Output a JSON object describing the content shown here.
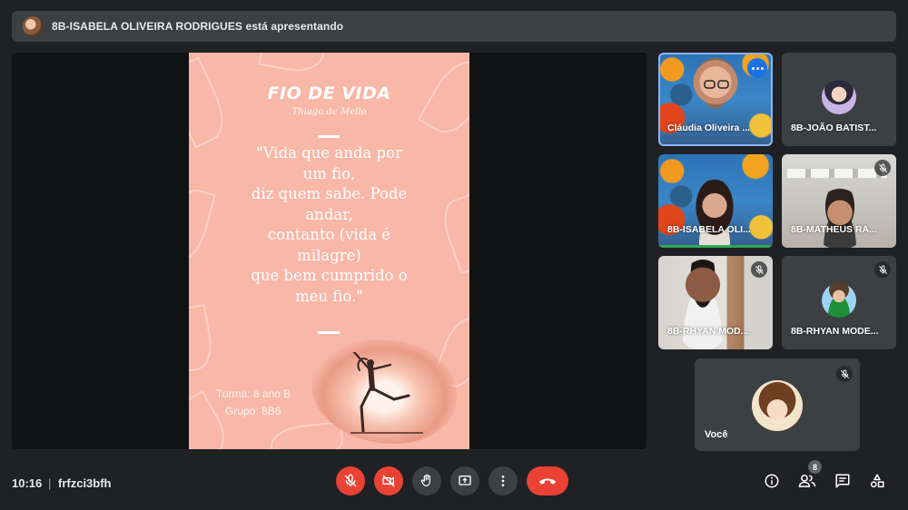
{
  "banner": {
    "presenter_text": "8B-ISABELA OLIVEIRA RODRIGUES está apresentando"
  },
  "slide": {
    "title": "FIO DE VIDA",
    "author": "Thiago de Mello",
    "poem_lines": [
      "\"Vida que anda por",
      "um fio,",
      "diz quem sabe. Pode",
      "andar,",
      "contanto (vida é",
      "milagre)",
      "que bem cumprido o",
      "meu fio.\""
    ],
    "class_label": "Turma: 8 ano B",
    "group_label": "Grupo: 8B6",
    "background_color": "#f9b7a8"
  },
  "participants": [
    {
      "name": "Cláudia Oliveira ...",
      "muted": false
    },
    {
      "name": "8B-JOÃO BATIST...",
      "muted": false
    },
    {
      "name": "8B-ISABELA OLI...",
      "muted": false
    },
    {
      "name": "8B-MATHEUS RA...",
      "muted": true
    },
    {
      "name": "8B-RHYAN MOD...",
      "muted": true
    },
    {
      "name": "8B-RHYAN MODE...",
      "muted": true
    }
  ],
  "self": {
    "name": "Você",
    "muted": true
  },
  "footer": {
    "time": "10:16",
    "separator": "|",
    "meeting_code": "frfzci3bfh",
    "participant_count": "8"
  },
  "colors": {
    "accent_blue": "#1a73e8",
    "danger_red": "#ea4335",
    "surface": "#3c4043",
    "background": "#202124"
  }
}
